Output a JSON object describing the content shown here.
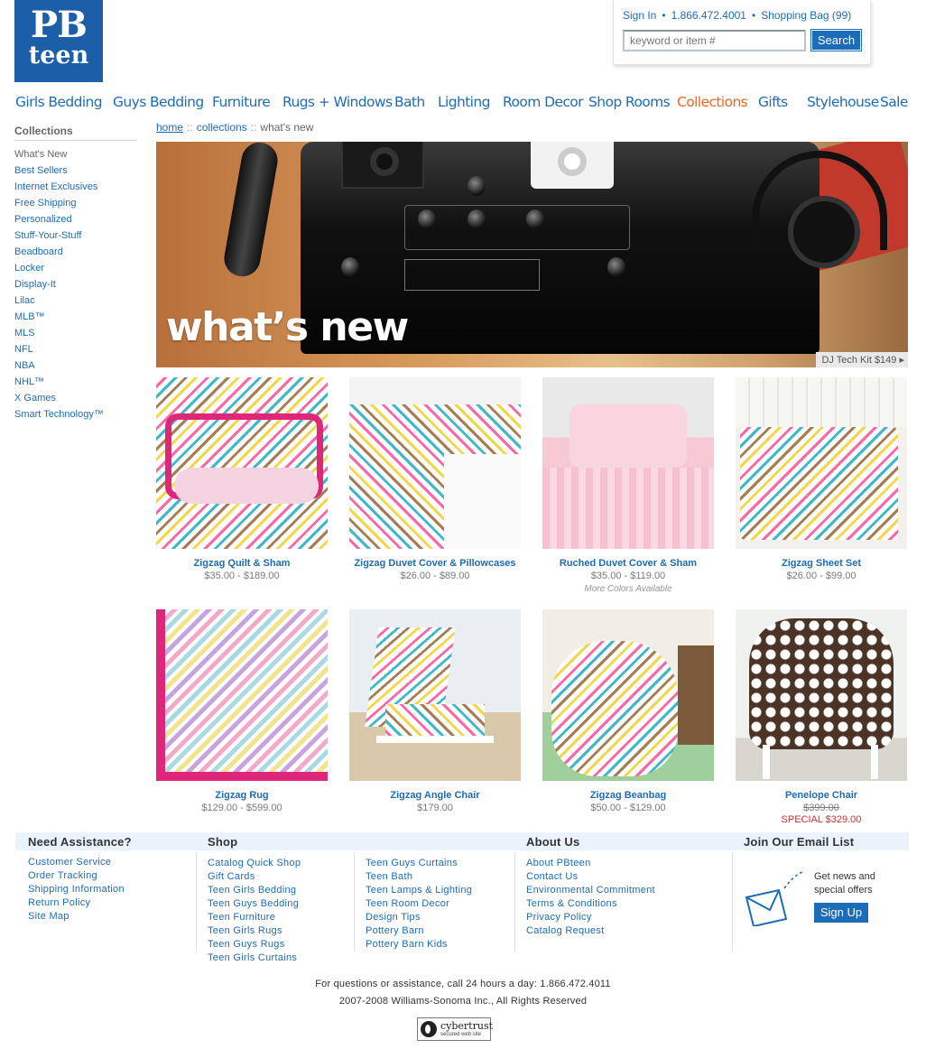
{
  "logo": {
    "line1": "PB",
    "line2": "teen"
  },
  "utility": {
    "sign_in": "Sign In",
    "phone": "1.866.472.4001",
    "bag": "Shopping Bag (99)",
    "sep": "•",
    "search_placeholder": "keyword or item #",
    "search_button": "Search"
  },
  "nav": [
    "Girls Bedding",
    "Guys Bedding",
    "Furniture",
    "Rugs + Windows",
    "Bath",
    "Lighting",
    "Room Decor",
    "Shop Rooms",
    "Collections",
    "Gifts",
    "Stylehouse",
    "Sale"
  ],
  "nav_active": "Collections",
  "sidebar": {
    "heading": "Collections",
    "items": [
      "What's New",
      "Best Sellers",
      "Internet Exclusives",
      "Free Shipping",
      "Personalized",
      "Stuff-Your-Stuff",
      "Beadboard",
      "Locker",
      "Display-It",
      "Lilac",
      "MLB™",
      "MLS",
      "NFL",
      "NBA",
      "NHL™",
      "X Games",
      "Smart Technology™"
    ]
  },
  "breadcrumb": {
    "home": "home",
    "sep": "::",
    "collections": "collections",
    "current": "what's new"
  },
  "hero": {
    "title": "what’s new",
    "tag": "DJ Tech Kit $149 ▸"
  },
  "products": [
    {
      "name": "Zigzag Quilt & Sham",
      "price": "$35.00 - $189.00"
    },
    {
      "name": "Zigzag Duvet Cover & Pillowcases",
      "price": "$26.00 - $89.00"
    },
    {
      "name": "Ruched Duvet Cover & Sham",
      "price": "$35.00 - $119.00",
      "note": "More Colors Available"
    },
    {
      "name": "Zigzag Sheet Set",
      "price": "$26.00 - $99.00"
    },
    {
      "name": "Zigzag Rug",
      "price": "$129.00 - $599.00"
    },
    {
      "name": "Zigzag Angle Chair",
      "price": "$179.00"
    },
    {
      "name": "Zigzag Beanbag",
      "price": "$50.00 - $129.00"
    },
    {
      "name": "Penelope Chair",
      "old_price": "$399.00",
      "special": "SPECIAL $329.00"
    }
  ],
  "footer": {
    "assist_heading": "Need Assistance?",
    "assist": [
      "Customer Service",
      "Order Tracking",
      "Shipping Information",
      "Return Policy",
      "Site Map"
    ],
    "shop_heading": "Shop",
    "shop_col1": [
      "Catalog Quick Shop",
      "Gift Cards",
      "Teen Girls Bedding",
      "Teen Guys Bedding",
      "Teen Furniture",
      "Teen Girls Rugs",
      "Teen Guys Rugs",
      "Teen Girls Curtains"
    ],
    "shop_col2": [
      "Teen Guys Curtains",
      "Teen Bath",
      "Teen Lamps & Lighting",
      "Teen Room Decor",
      "Design Tips",
      "Pottery Barn",
      "Pottery Barn Kids"
    ],
    "about_heading": "About Us",
    "about": [
      "About PBteen",
      "Contact Us",
      "Environmental Commitment",
      "Terms & Conditions",
      "Privacy Policy",
      "Catalog Request"
    ],
    "email_heading": "Join Our Email List",
    "email_line1": "Get news and",
    "email_line2": "special offers",
    "signup": "Sign Up"
  },
  "bottom": {
    "assist_line": "For questions or assistance, call 24 hours a day: 1.866.472.4011",
    "copyright": "2007-2008 Williams-Sonoma Inc., All Rights Reserved",
    "badge_top": "cybertrust",
    "badge_bottom": "secured web site"
  }
}
